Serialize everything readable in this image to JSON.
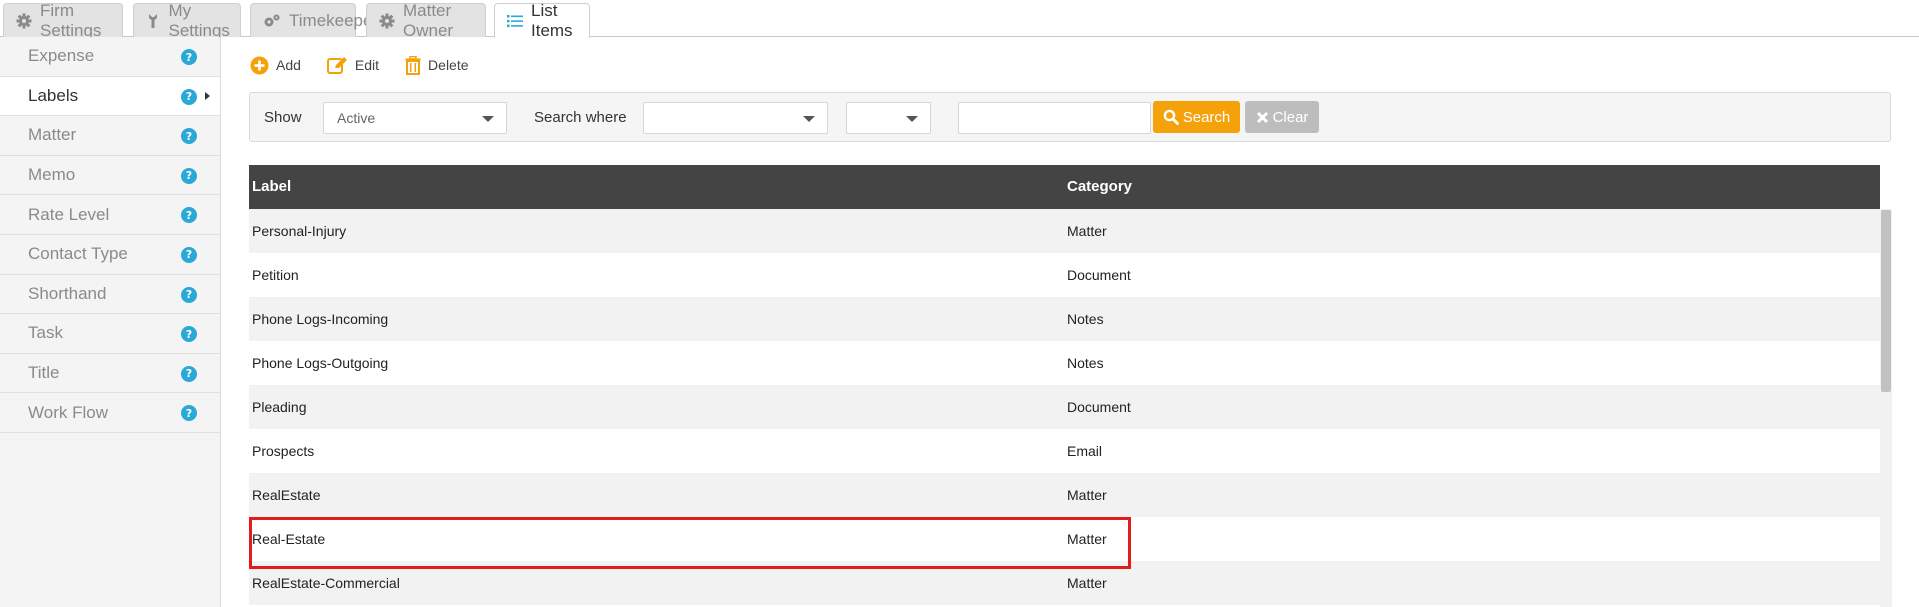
{
  "tabs": [
    {
      "label": "Firm Settings",
      "icon": "gear-icon"
    },
    {
      "label": "My Settings",
      "icon": "wrench-icon"
    },
    {
      "label": "Timekeeper",
      "icon": "gears-icon"
    },
    {
      "label": "Matter Owner",
      "icon": "gear-icon"
    },
    {
      "label": "List Items",
      "icon": "list-icon",
      "active": true
    }
  ],
  "sidebar": {
    "items": [
      {
        "label": "Expense"
      },
      {
        "label": "Labels",
        "active": true
      },
      {
        "label": "Matter"
      },
      {
        "label": "Memo"
      },
      {
        "label": "Rate Level"
      },
      {
        "label": "Contact Type"
      },
      {
        "label": "Shorthand"
      },
      {
        "label": "Task"
      },
      {
        "label": "Title"
      },
      {
        "label": "Work Flow"
      }
    ],
    "help_glyph": "?"
  },
  "toolbar": {
    "add_label": "Add",
    "edit_label": "Edit",
    "delete_label": "Delete"
  },
  "filter": {
    "show_label": "Show",
    "show_value": "Active",
    "search_where_label": "Search where",
    "field_value": "",
    "operator_value": "",
    "search_text": "",
    "search_button": "Search",
    "clear_button": "Clear"
  },
  "grid": {
    "columns": [
      "Label",
      "Category"
    ],
    "rows": [
      [
        "Personal-Injury",
        "Matter"
      ],
      [
        "Petition",
        "Document"
      ],
      [
        "Phone Logs-Incoming",
        "Notes"
      ],
      [
        "Phone Logs-Outgoing",
        "Notes"
      ],
      [
        "Pleading",
        "Document"
      ],
      [
        "Prospects",
        "Email"
      ],
      [
        "RealEstate",
        "Matter"
      ],
      [
        "Real-Estate",
        "Matter"
      ],
      [
        "RealEstate-Commercial",
        "Matter"
      ]
    ],
    "highlighted_row": 7
  },
  "colors": {
    "accent_orange": "#f5a10a",
    "help_blue": "#2aa9d8",
    "header_dark": "#444444",
    "highlight_red": "#e41b1b"
  }
}
